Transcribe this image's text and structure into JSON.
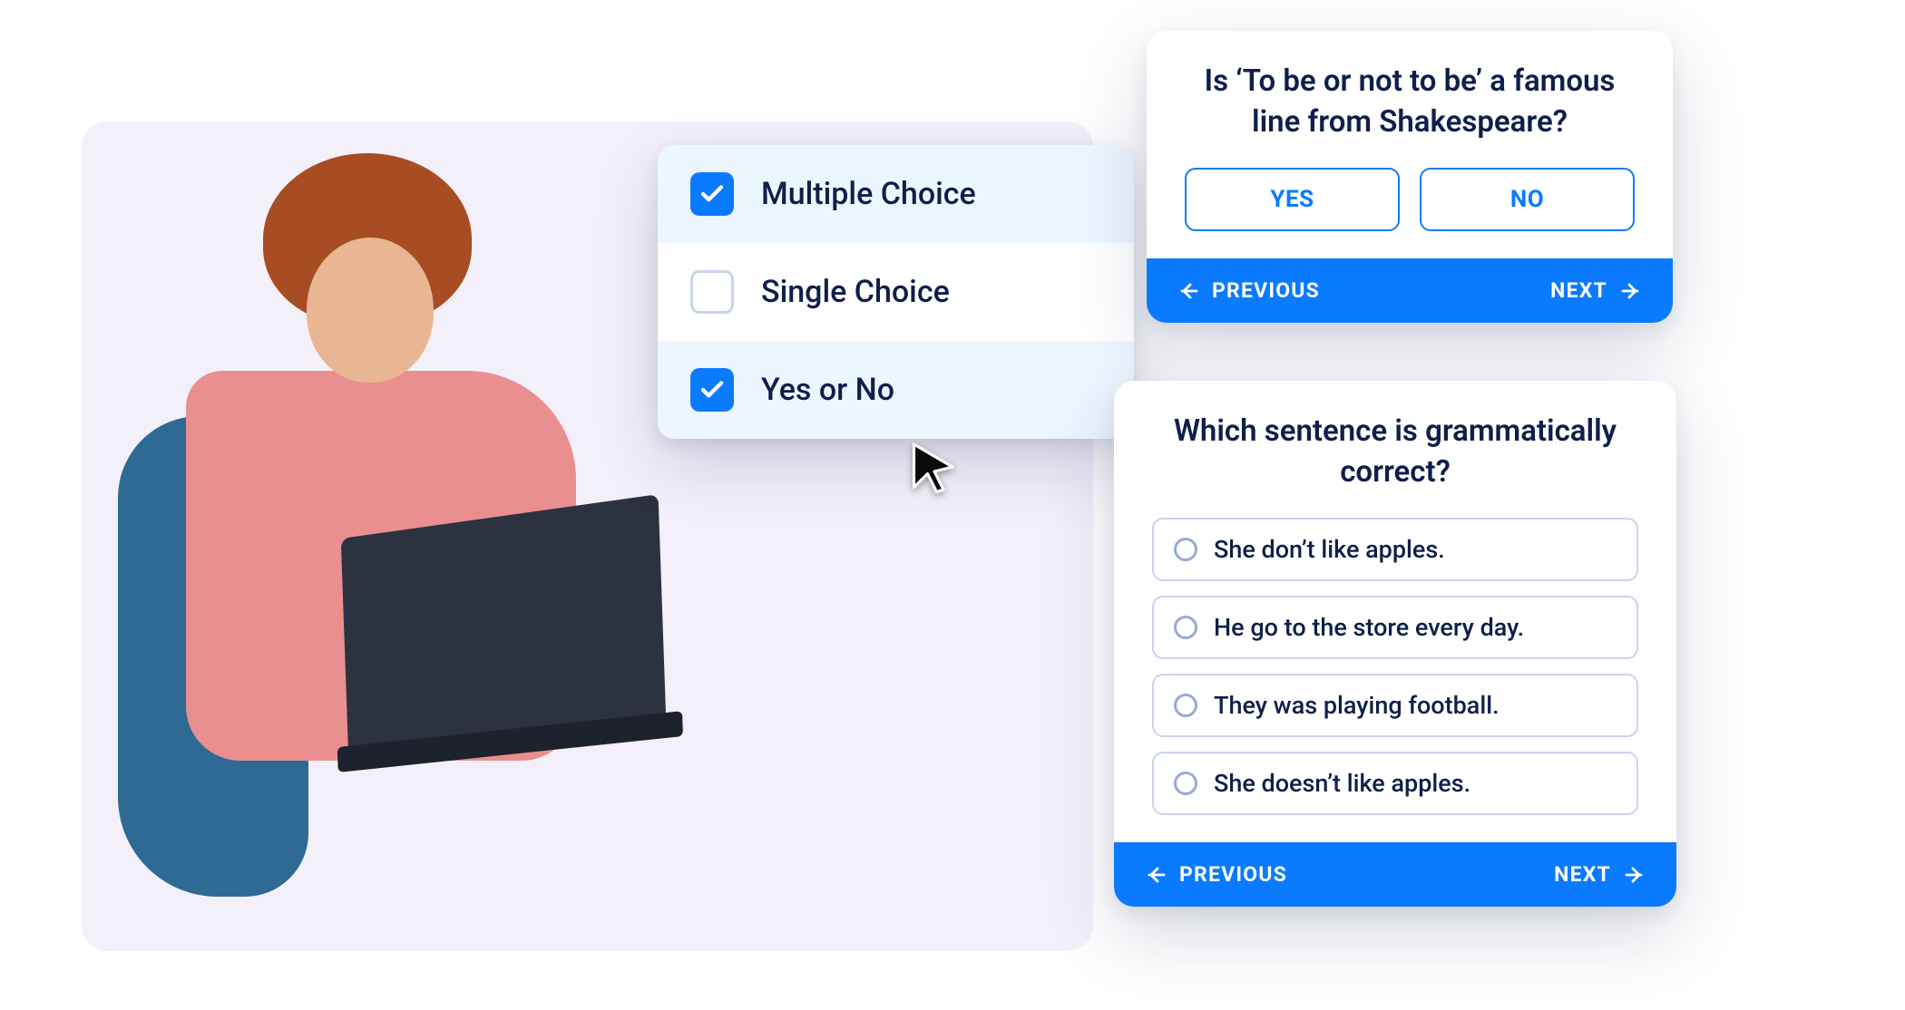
{
  "options": [
    {
      "label": "Multiple Choice",
      "checked": true
    },
    {
      "label": "Single Choice",
      "checked": false
    },
    {
      "label": "Yes or No",
      "checked": true
    }
  ],
  "yesno_card": {
    "question": "Is ‘To be or not to be’ a famous line from Shakespeare?",
    "yes_label": "YES",
    "no_label": "NO"
  },
  "grammar_card": {
    "question": "Which sentence is grammatically correct?",
    "choices": [
      "She don’t like apples.",
      "He go to the store every day.",
      "They was playing football.",
      "She doesn’t like apples."
    ]
  },
  "nav": {
    "previous": "PREVIOUS",
    "next": "NEXT"
  }
}
